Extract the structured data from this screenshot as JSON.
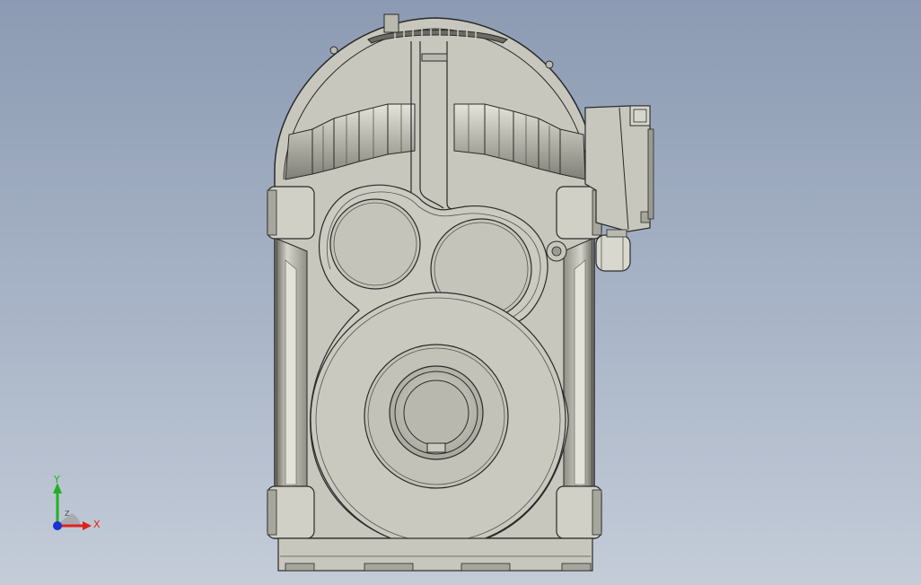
{
  "triad": {
    "x_label": "X",
    "y_label": "Y",
    "z_label": "Z",
    "x_color": "#e0201c",
    "y_color": "#1fb31f",
    "z_color": "#1a2fd6"
  },
  "colors": {
    "bg_top": "#8c9bb3",
    "bg_bottom": "#c4ccd8",
    "body": "#c7c7bd",
    "shade": "#9a9a90",
    "edge": "#2a2a2a"
  },
  "icons": {
    "triad": "axis-triad-icon"
  }
}
